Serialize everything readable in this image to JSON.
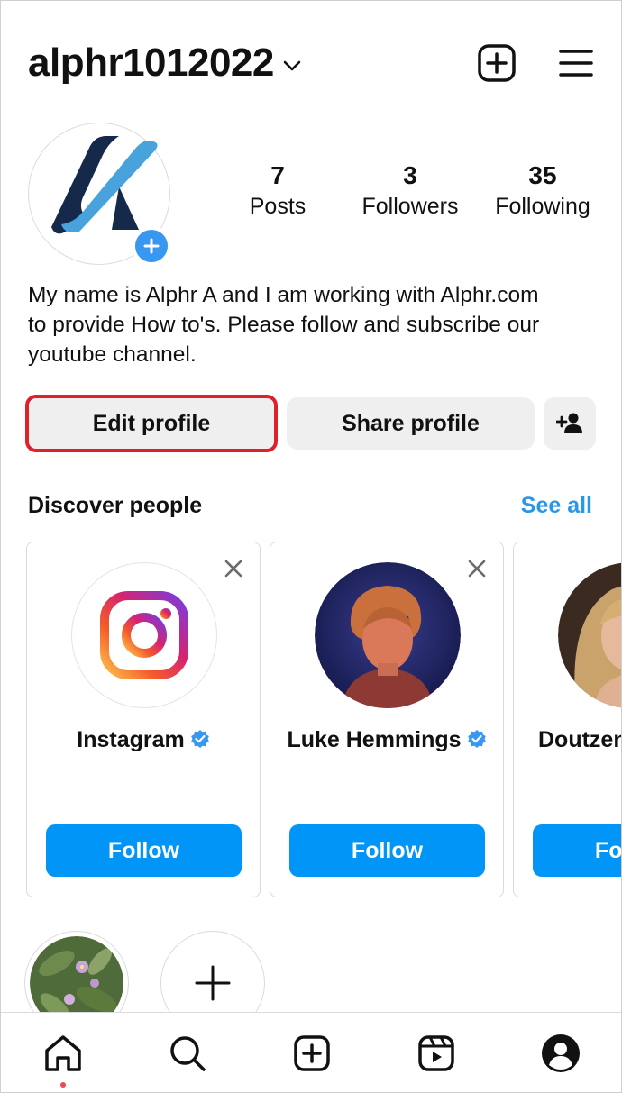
{
  "header": {
    "username": "alphr1012022",
    "create_icon": "plus-square-icon",
    "menu_icon": "hamburger-menu-icon"
  },
  "profile": {
    "stats": [
      {
        "value": "7",
        "label": "Posts"
      },
      {
        "value": "3",
        "label": "Followers"
      },
      {
        "value": "35",
        "label": "Following"
      }
    ],
    "bio_lines": [
      "My name is Alphr A and I am working with Alphr.com",
      "to provide How to's. Please follow and subscribe our",
      "youtube channel."
    ]
  },
  "actions": {
    "edit_profile": "Edit profile",
    "share_profile": "Share profile",
    "add_person_icon": "add-person-icon"
  },
  "discover": {
    "title": "Discover people",
    "see_all": "See all",
    "cards": [
      {
        "name": "Instagram",
        "follow": "Follow",
        "verified": true
      },
      {
        "name": "Luke Hemmings",
        "follow": "Follow",
        "verified": true
      },
      {
        "name": "Doutzen",
        "follow": "Follow",
        "verified": false
      }
    ]
  },
  "colors": {
    "accent_blue": "#0095f6",
    "link_blue": "#2a96e8",
    "highlight_red": "#e0202b",
    "button_grey": "#efefef"
  },
  "bottom_nav": [
    "home-icon",
    "search-icon",
    "create-icon",
    "reels-icon",
    "profile-icon"
  ]
}
